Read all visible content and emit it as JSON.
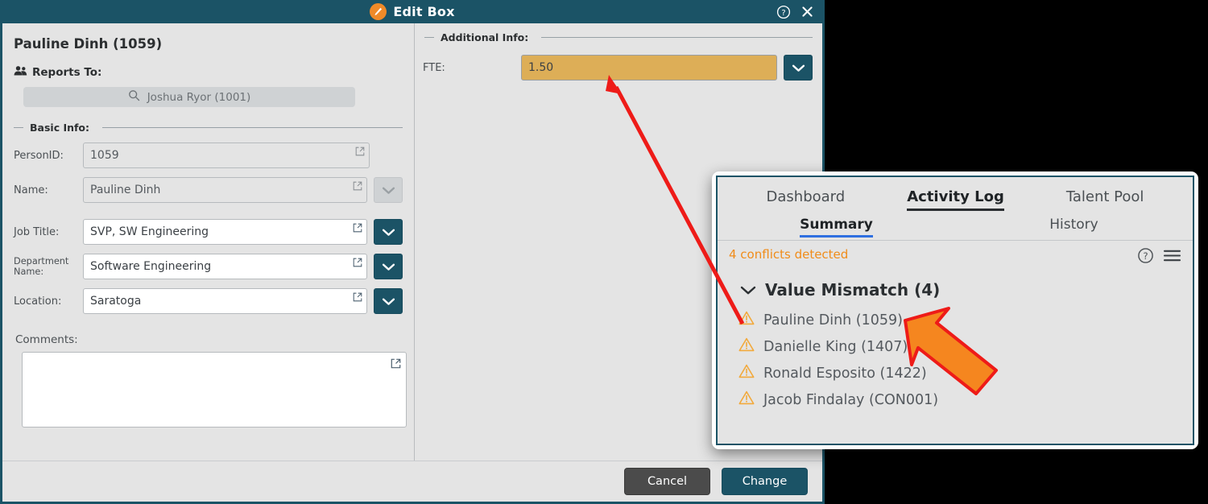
{
  "window": {
    "title": "Edit Box",
    "logo_icon": "pencil-circle-icon",
    "help_icon": "help-circle-icon",
    "close_icon": "close-icon"
  },
  "left_pane": {
    "person_title": "Pauline Dinh (1059)",
    "reports_to": {
      "icon": "people-icon",
      "label": "Reports To:",
      "search_icon": "search-icon",
      "value": "Joshua Ryor (1001)"
    },
    "basic_info": {
      "legend": "Basic Info:",
      "fields": [
        {
          "label": "PersonID:",
          "value": "1059",
          "disabled": true,
          "has_dropdown": false,
          "popout_icon": "popout-icon"
        },
        {
          "label": "Name:",
          "value": "Pauline Dinh",
          "disabled": true,
          "has_dropdown": true,
          "dropdown_disabled": true,
          "popout_icon": "popout-icon"
        },
        {
          "label": "Job Title:",
          "value": "SVP, SW Engineering",
          "disabled": false,
          "has_dropdown": true,
          "dropdown_disabled": false,
          "popout_icon": "popout-icon"
        },
        {
          "label": "Department Name:",
          "value": "Software Engineering",
          "disabled": false,
          "has_dropdown": true,
          "dropdown_disabled": false,
          "popout_icon": "popout-icon"
        },
        {
          "label": "Location:",
          "value": "Saratoga",
          "disabled": false,
          "has_dropdown": true,
          "dropdown_disabled": false,
          "popout_icon": "popout-icon"
        }
      ]
    },
    "comments": {
      "label": "Comments:",
      "value": "",
      "popout_icon": "popout-icon"
    }
  },
  "right_pane": {
    "legend": "Additional Info:",
    "fte": {
      "label": "FTE:",
      "value": "1.50",
      "highlighted": true,
      "highlight_color": "#ddae57",
      "dropdown_icon": "chevron-down-icon"
    }
  },
  "footer": {
    "cancel_label": "Cancel",
    "change_label": "Change"
  },
  "overlay": {
    "main_tabs": [
      {
        "label": "Dashboard",
        "active": false
      },
      {
        "label": "Activity Log",
        "active": true
      },
      {
        "label": "Talent Pool",
        "active": false
      }
    ],
    "sub_tabs": [
      {
        "label": "Summary",
        "active": true
      },
      {
        "label": "History",
        "active": false
      }
    ],
    "conflict_count_text": "4 conflicts detected",
    "conflict_count_color": "#f08c1a",
    "help_icon": "help-circle-icon",
    "menu_icon": "hamburger-menu-icon",
    "group": {
      "chevron_icon": "chevron-down-icon",
      "title": "Value Mismatch (4)"
    },
    "items": [
      {
        "icon": "warning-triangle-icon",
        "label": "Pauline Dinh (1059)"
      },
      {
        "icon": "warning-triangle-icon",
        "label": "Danielle King (1407)"
      },
      {
        "icon": "warning-triangle-icon",
        "label": "Ronald Esposito (1422)"
      },
      {
        "icon": "warning-triangle-icon",
        "label": "Jacob Findalay (CON001)"
      }
    ]
  },
  "annotations": {
    "arrow_icon": "red-arrow-annotation",
    "cursor_icon": "orange-cursor-arrow"
  },
  "theme": {
    "accent_teal": "#1b5366",
    "logo_orange": "#ef8a28",
    "warning_amber": "#f2a93b",
    "highlight_gold": "#ddae57",
    "active_blue": "#2f6fe0",
    "panel_gray": "#e4e4e4"
  }
}
